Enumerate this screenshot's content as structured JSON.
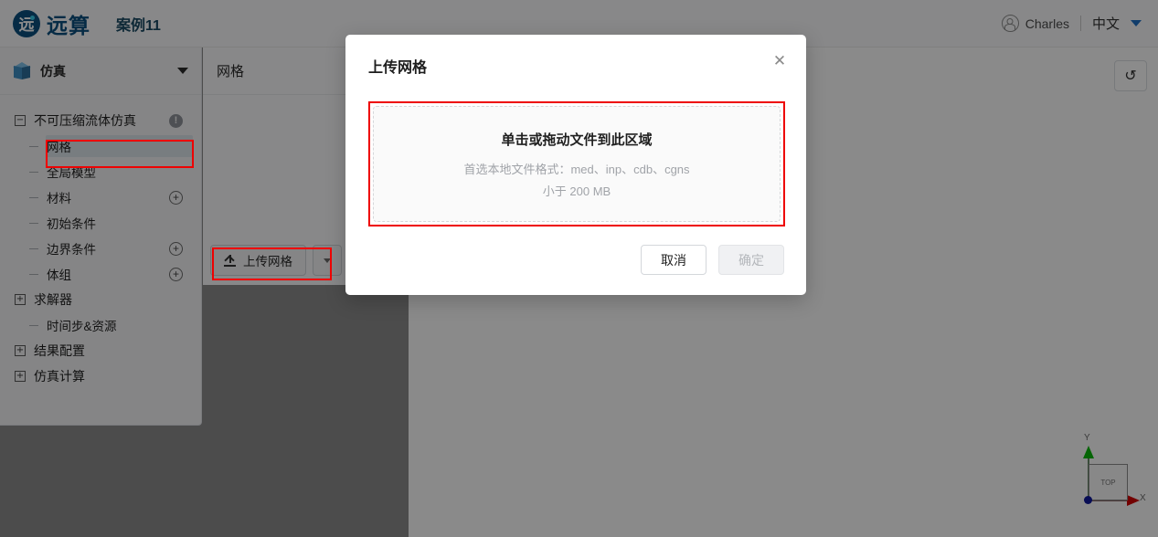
{
  "header": {
    "logo_glyph": "远",
    "logo_text": "远算",
    "project_title": "案例11",
    "user_name": "Charles",
    "language": "中文",
    "user_icon": "user-circle-icon",
    "caret_icon": "chevron-down-icon"
  },
  "sidebar": {
    "panel_title": "仿真",
    "panel_icon": "cube-icon",
    "panel_caret": "chevron-down-icon",
    "tree": [
      {
        "label": "不可压缩流体仿真",
        "expander": "−",
        "badge": "warning-icon",
        "level": 0
      },
      {
        "label": "网格",
        "expander": "",
        "badge": "",
        "level": 1,
        "selected": true
      },
      {
        "label": "全局模型",
        "expander": "",
        "badge": "",
        "level": 1
      },
      {
        "label": "材料",
        "expander": "",
        "badge": "plus-icon",
        "level": 1
      },
      {
        "label": "初始条件",
        "expander": "",
        "badge": "",
        "level": 1
      },
      {
        "label": "边界条件",
        "expander": "",
        "badge": "plus-icon",
        "level": 1
      },
      {
        "label": "体组",
        "expander": "",
        "badge": "plus-icon",
        "level": 1
      },
      {
        "label": "求解器",
        "expander": "+",
        "badge": "",
        "level": 0
      },
      {
        "label": "时间步&资源",
        "expander": "",
        "badge": "",
        "level": 1
      },
      {
        "label": "结果配置",
        "expander": "+",
        "badge": "",
        "level": 0
      },
      {
        "label": "仿真计算",
        "expander": "+",
        "badge": "",
        "level": 0
      }
    ]
  },
  "mesh_panel": {
    "title": "网格",
    "upload_button": "上传网格",
    "upload_icon": "upload-icon",
    "more_icon": "chevron-down-icon"
  },
  "viewport": {
    "reset_icon": "refresh-icon",
    "gizmo": {
      "face_label": "TOP",
      "y_label": "Y",
      "x_label": "X"
    }
  },
  "modal": {
    "title": "上传网格",
    "close_icon": "close-icon",
    "dropzone_main": "单击或拖动文件到此区域",
    "dropzone_formats": "首选本地文件格式：med、inp、cdb、cgns",
    "dropzone_size": "小于 200 MB",
    "cancel_label": "取消",
    "confirm_label": "确定"
  },
  "colors": {
    "brand": "#0b4f7f",
    "highlight_red": "#ee0000",
    "accent_blue": "#1f6fc4"
  }
}
